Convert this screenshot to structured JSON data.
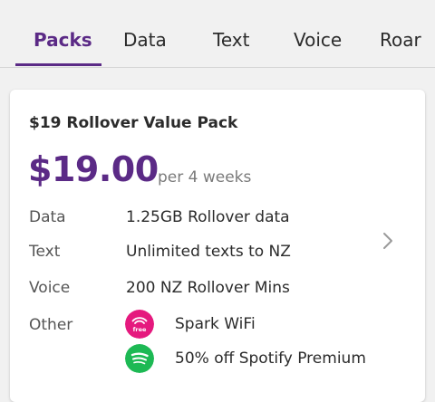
{
  "tabs": [
    {
      "label": "Packs",
      "active": true
    },
    {
      "label": "Data"
    },
    {
      "label": "Text"
    },
    {
      "label": "Voice"
    },
    {
      "label": "Roar"
    }
  ],
  "card": {
    "title": "$19 Rollover Value Pack",
    "price": "$19.00",
    "period": "per 4 weeks",
    "rows": [
      {
        "label": "Data",
        "value": "1.25GB Rollover data"
      },
      {
        "label": "Text",
        "value": "Unlimited texts to NZ"
      },
      {
        "label": "Voice",
        "value": "200 NZ Rollover Mins"
      },
      {
        "label": "Other"
      }
    ],
    "extras": [
      {
        "label": "Spark WiFi",
        "icon": "spark-wifi-icon",
        "icon_text": "free",
        "color": "#e5197e"
      },
      {
        "label": "50% off Spotify Premium",
        "icon": "spotify-icon",
        "color": "#1db954"
      }
    ]
  },
  "colors": {
    "accent": "#5b2a86",
    "background": "#f1f1f1"
  }
}
